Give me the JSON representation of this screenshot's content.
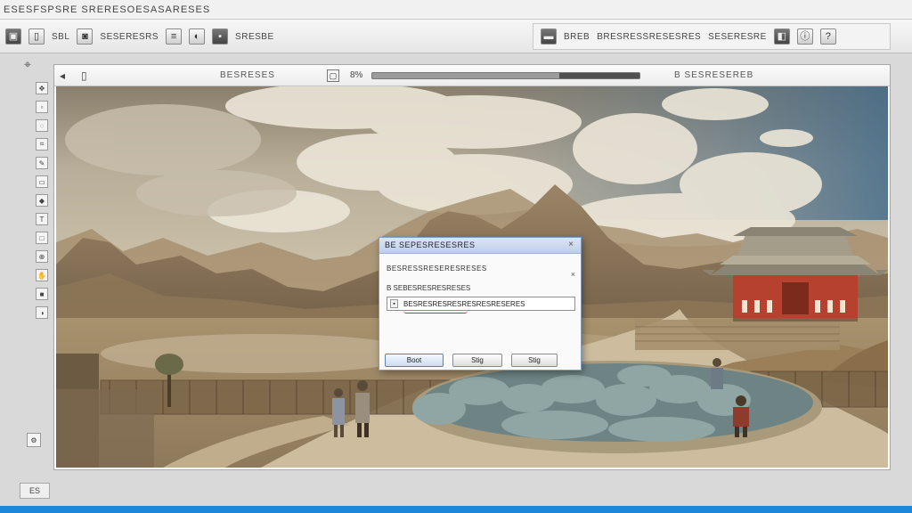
{
  "menubar": {
    "text": "ESESFSPSRE SRERESOESASARESES"
  },
  "toolbar": {
    "left_label1": "SBL",
    "left_label2": "SESERESRS",
    "left_label3": "SRESBE",
    "right_label1": "BREB",
    "right_label2": "BRESRESSRESESRES",
    "right_label3": "SESERESRE"
  },
  "document": {
    "file_name": "BESRESES",
    "zoom_text": "8%",
    "zoom_fraction": 0.3,
    "info_text": "B SESRESEREB"
  },
  "dialog": {
    "title": "BE SEPESRESESRES",
    "line1": "BESRESSRESERESRESES",
    "line2": "B SEBESRESRESRESES",
    "field_value": "BESRESRESRESRESRESRESERES",
    "button_ok": "Boot",
    "button_2": "Stig",
    "button_3": "Stig"
  },
  "status": {
    "chip": "ES"
  },
  "colors": {
    "accent_blue": "#1e88d8",
    "dialog_border": "#7d9bc4",
    "temple_red": "#b5412e"
  }
}
